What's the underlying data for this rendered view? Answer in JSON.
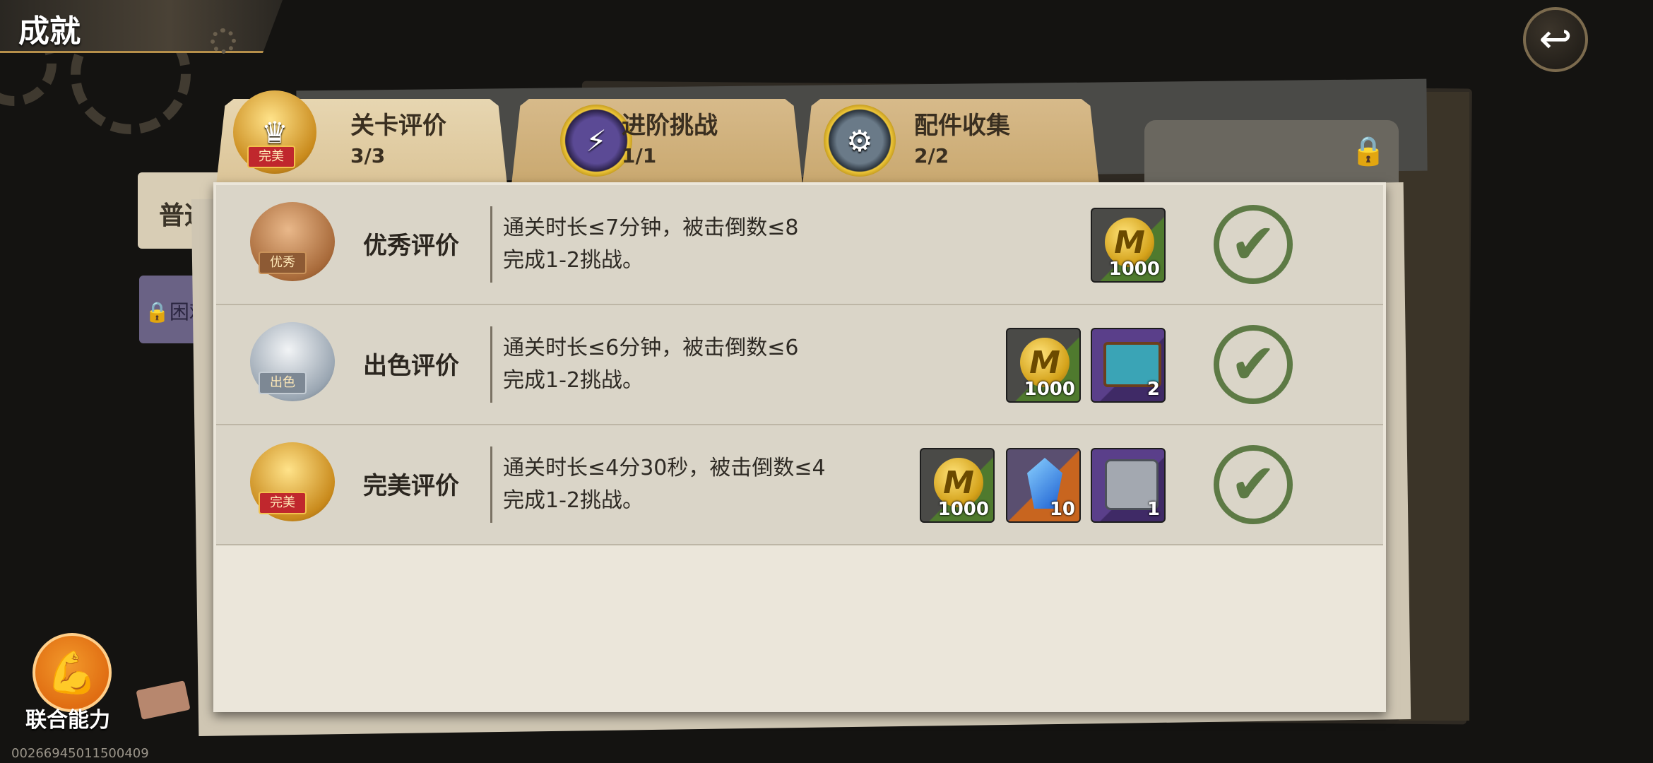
{
  "header": {
    "title": "成就"
  },
  "tabs": [
    {
      "label": "关卡评价",
      "count": "3/3",
      "active": true,
      "badge": "完美"
    },
    {
      "label": "进阶挑战",
      "count": "1/1",
      "active": false
    },
    {
      "label": "配件收集",
      "count": "2/2",
      "active": false
    }
  ],
  "side_tabs": {
    "normal": "普通",
    "hard": "困难"
  },
  "rows": [
    {
      "name": "优秀评价",
      "badge": "优秀",
      "line1": "通关时长≤7分钟，被击倒数≤8",
      "line2": "完成1-2挑战。",
      "rewards": [
        {
          "icon": "coin-icon",
          "qty": "1000",
          "frame": "green"
        }
      ],
      "completed": true
    },
    {
      "name": "出色评价",
      "badge": "出色",
      "line1": "通关时长≤6分钟，被击倒数≤6",
      "line2": "完成1-2挑战。",
      "rewards": [
        {
          "icon": "coin-icon",
          "qty": "1000",
          "frame": "green"
        },
        {
          "icon": "chest-icon",
          "qty": "2",
          "frame": "purple"
        }
      ],
      "completed": true
    },
    {
      "name": "完美评价",
      "badge": "完美",
      "line1": "通关时长≤4分30秒，被击倒数≤4",
      "line2": "完成1-2挑战。",
      "rewards": [
        {
          "icon": "coin-icon",
          "qty": "1000",
          "frame": "green"
        },
        {
          "icon": "crystal-icon",
          "qty": "10",
          "frame": "orange"
        },
        {
          "icon": "box-icon",
          "qty": "1",
          "frame": "purple"
        }
      ],
      "completed": true
    }
  ],
  "footer": {
    "ability_label": "联合能力",
    "player_id": "002669450115004​09"
  },
  "colors": {
    "accent_gold": "#c98a1c",
    "check_green": "#5d7a45",
    "paper": "#ebe6da"
  }
}
